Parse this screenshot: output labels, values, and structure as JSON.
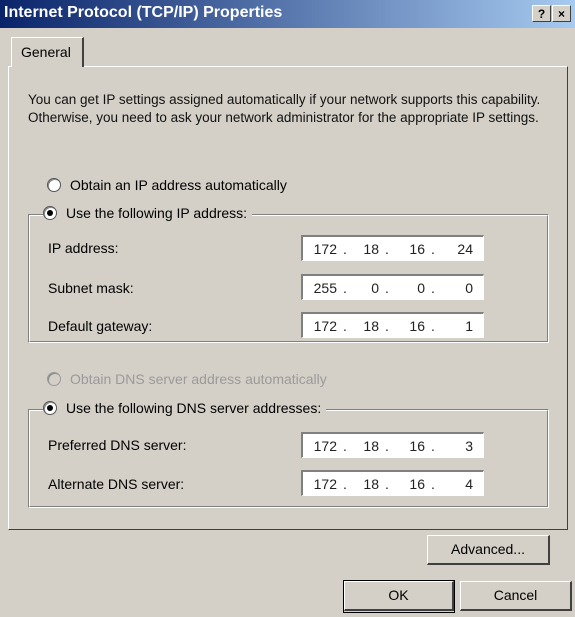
{
  "window": {
    "title": "Internet Protocol (TCP/IP) Properties",
    "help_button": "?",
    "close_button": "×"
  },
  "tabs": [
    {
      "label": "General"
    }
  ],
  "description": "You can get IP settings assigned automatically if your network supports this capability. Otherwise, you need to ask your network administrator for the appropriate IP settings.",
  "ip_mode": {
    "auto_label": "Obtain an IP address automatically",
    "manual_label": "Use the following IP address:",
    "selected": "manual"
  },
  "ip_fields": [
    {
      "label": "IP address:",
      "octets": [
        "172",
        "18",
        "16",
        "24"
      ]
    },
    {
      "label": "Subnet mask:",
      "octets": [
        "255",
        "0",
        "0",
        "0"
      ]
    },
    {
      "label": "Default gateway:",
      "octets": [
        "172",
        "18",
        "16",
        "1"
      ]
    }
  ],
  "dns_mode": {
    "auto_label": "Obtain DNS server address automatically",
    "manual_label": "Use the following DNS server addresses:",
    "selected": "manual"
  },
  "dns_fields": [
    {
      "label": "Preferred DNS server:",
      "octets": [
        "172",
        "18",
        "16",
        "3"
      ]
    },
    {
      "label": "Alternate DNS server:",
      "octets": [
        "172",
        "18",
        "16",
        "4"
      ]
    }
  ],
  "buttons": {
    "advanced": "Advanced...",
    "ok": "OK",
    "cancel": "Cancel"
  }
}
